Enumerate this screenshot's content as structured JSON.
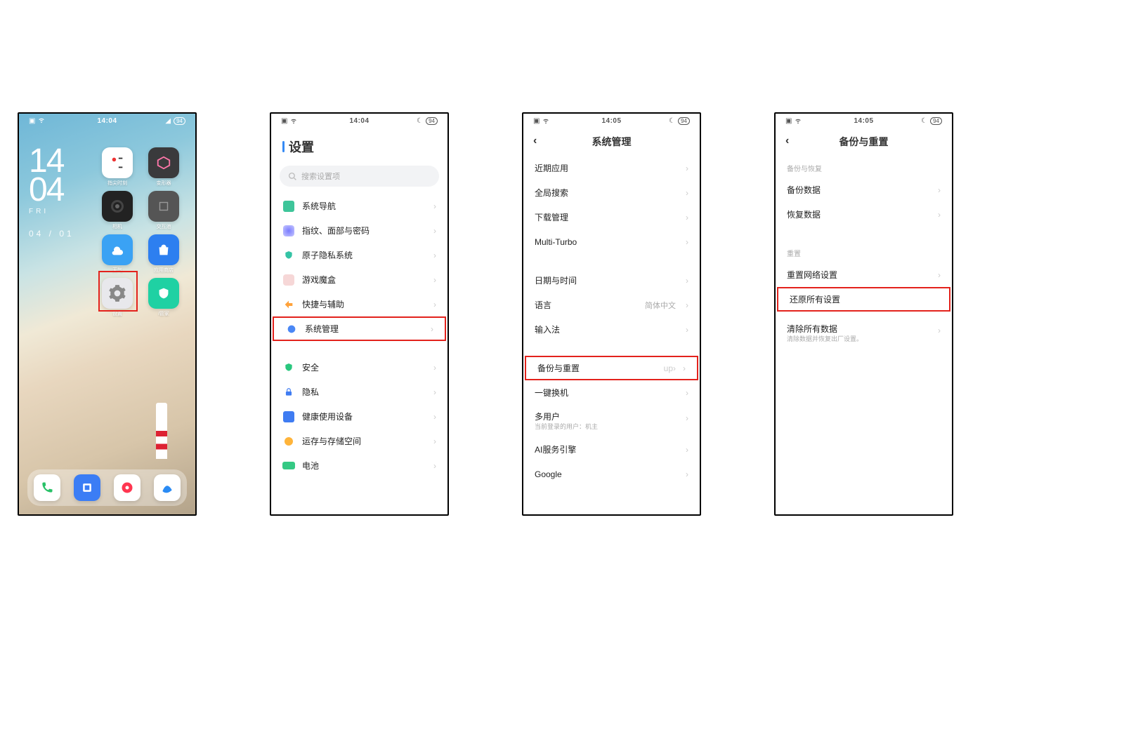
{
  "status": {
    "time_home": "14:04",
    "time_s2": "14:04",
    "time_s3": "14:05",
    "time_s4": "14:05",
    "battery": "94"
  },
  "home": {
    "hh": "14",
    "mm": "04",
    "day": "FRI",
    "date": "04 / 01",
    "apps": {
      "a1": "指尖时刻",
      "a2": "变形器",
      "a3": "相机",
      "a4": "交互池",
      "a5": "天气",
      "a6": "应用商店",
      "a7": "设置",
      "a8": "i管家"
    }
  },
  "s2": {
    "title": "设置",
    "search_ph": "搜索设置项",
    "items": {
      "nav": "系统导航",
      "fp": "指纹、面部与密码",
      "atom": "原子隐私系统",
      "gamebox": "游戏魔盒",
      "shortcut": "快捷与辅助",
      "sysmgmt": "系统管理",
      "security": "安全",
      "privacy": "隐私",
      "health": "健康使用设备",
      "storage": "运存与存储空间",
      "battery": "电池"
    }
  },
  "s3": {
    "title": "系统管理",
    "items": {
      "recent": "近期应用",
      "gsearch": "全局搜索",
      "dl": "下载管理",
      "mturbo": "Multi-Turbo",
      "datetime": "日期与时间",
      "lang": "语言",
      "lang_val": "简体中文",
      "ime": "输入法",
      "backup": "备份与重置",
      "switch": "一键换机",
      "multiuser": "多用户",
      "multiuser_sub": "当前登录的用户：机主",
      "ai": "AI服务引擎",
      "google": "Google"
    }
  },
  "s4": {
    "title": "备份与重置",
    "sec1": "备份与恢复",
    "items": {
      "backup_data": "备份数据",
      "restore_data": "恢复数据"
    },
    "sec2": "重置",
    "items2": {
      "reset_net": "重置网络设置",
      "reset_all": "还原所有设置",
      "erase": "清除所有数据",
      "erase_sub": "清除数据并恢复出厂设置。"
    }
  }
}
